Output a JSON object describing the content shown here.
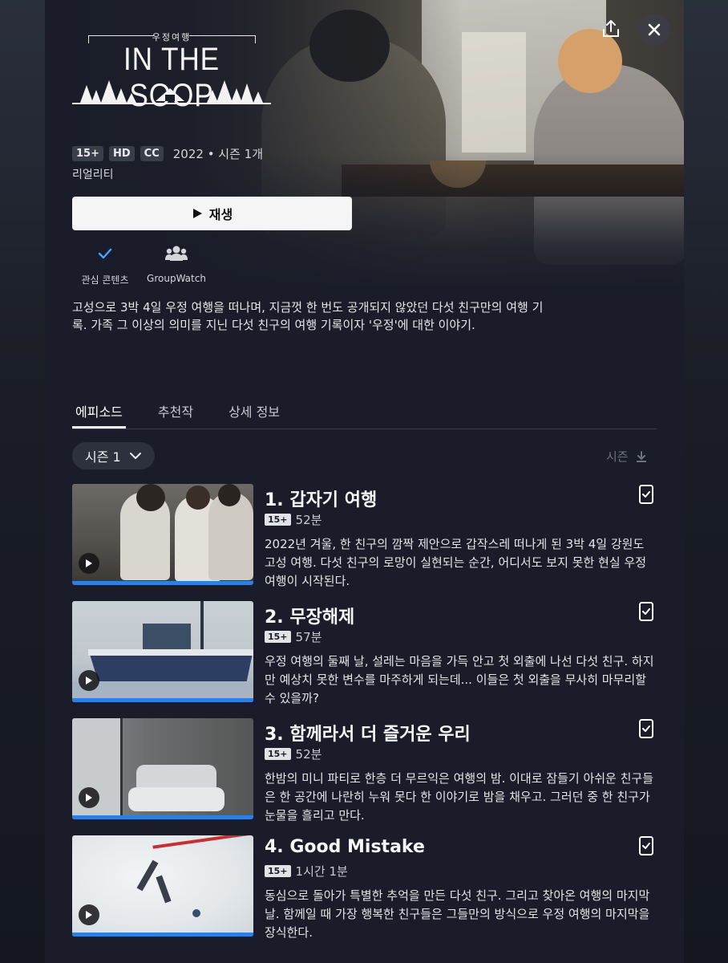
{
  "logo": {
    "tagline": "우정여행",
    "title": "IN THE SOOP"
  },
  "meta": {
    "badges": [
      "15+",
      "HD",
      "CC"
    ],
    "info": "2022 • 시즌 1개",
    "genre": "리얼리티"
  },
  "actions": {
    "play_label": "재생",
    "watchlist_label": "관심 콘텐츠",
    "groupwatch_label": "GroupWatch"
  },
  "description": "고성으로 3박 4일 우정 여행을 떠나며, 지금껏 한 번도 공개되지 않았던 다섯 친구만의 여행 기록. 가족 그 이상의 의미를 지닌 다섯 친구의 여행 기록이자 '우정'에 대한 이야기.",
  "tabs": [
    "에피소드",
    "추천작",
    "상세 정보"
  ],
  "season": {
    "selected": "시즌 1",
    "download_label": "시즌"
  },
  "episodes": [
    {
      "title": "1. 갑자기 여행",
      "rating": "15+",
      "duration": "52분",
      "description": "2022년 겨울, 한 친구의 깜짝 제안으로 갑작스레 떠나게 된 3박 4일 강원도 고성 여행. 다섯 친구의 로망이 실현되는 순간, 어디서도 보지 못한 현실 우정 여행이 시작된다."
    },
    {
      "title": "2. 무장해제",
      "rating": "15+",
      "duration": "57분",
      "description": "우정 여행의 둘째 날, 설레는 마음을 가득 안고 첫 외출에 나선 다섯 친구. 하지만 예상치 못한 변수를 마주하게 되는데... 이들은 첫 외출을 무사히 마무리할 수 있을까?"
    },
    {
      "title": "3. 함께라서 더 즐거운 우리",
      "rating": "15+",
      "duration": "52분",
      "description": "한밤의 미니 파티로 한층 더 무르익은 여행의 밤. 이대로 잠들기 아쉬운 친구들은 한 공간에 나란히 누워 못다 한 이야기로 밤을 채우고. 그러던 중 한 친구가 눈물을 흘리고 만다."
    },
    {
      "title": "4. Good Mistake",
      "rating": "15+",
      "duration": "1시간 1분",
      "description": "동심으로 돌아가 특별한 추억을 만든 다섯 친구. 그리고 찾아온 여행의 마지막 날. 함께일 때 가장 행복한 친구들은 그들만의 방식으로 우정 여행의 마지막을 장식한다."
    }
  ],
  "colors": {
    "background": "#1a1d29",
    "progress": "#2f7fe0",
    "accent_check": "#4aa3ff"
  }
}
